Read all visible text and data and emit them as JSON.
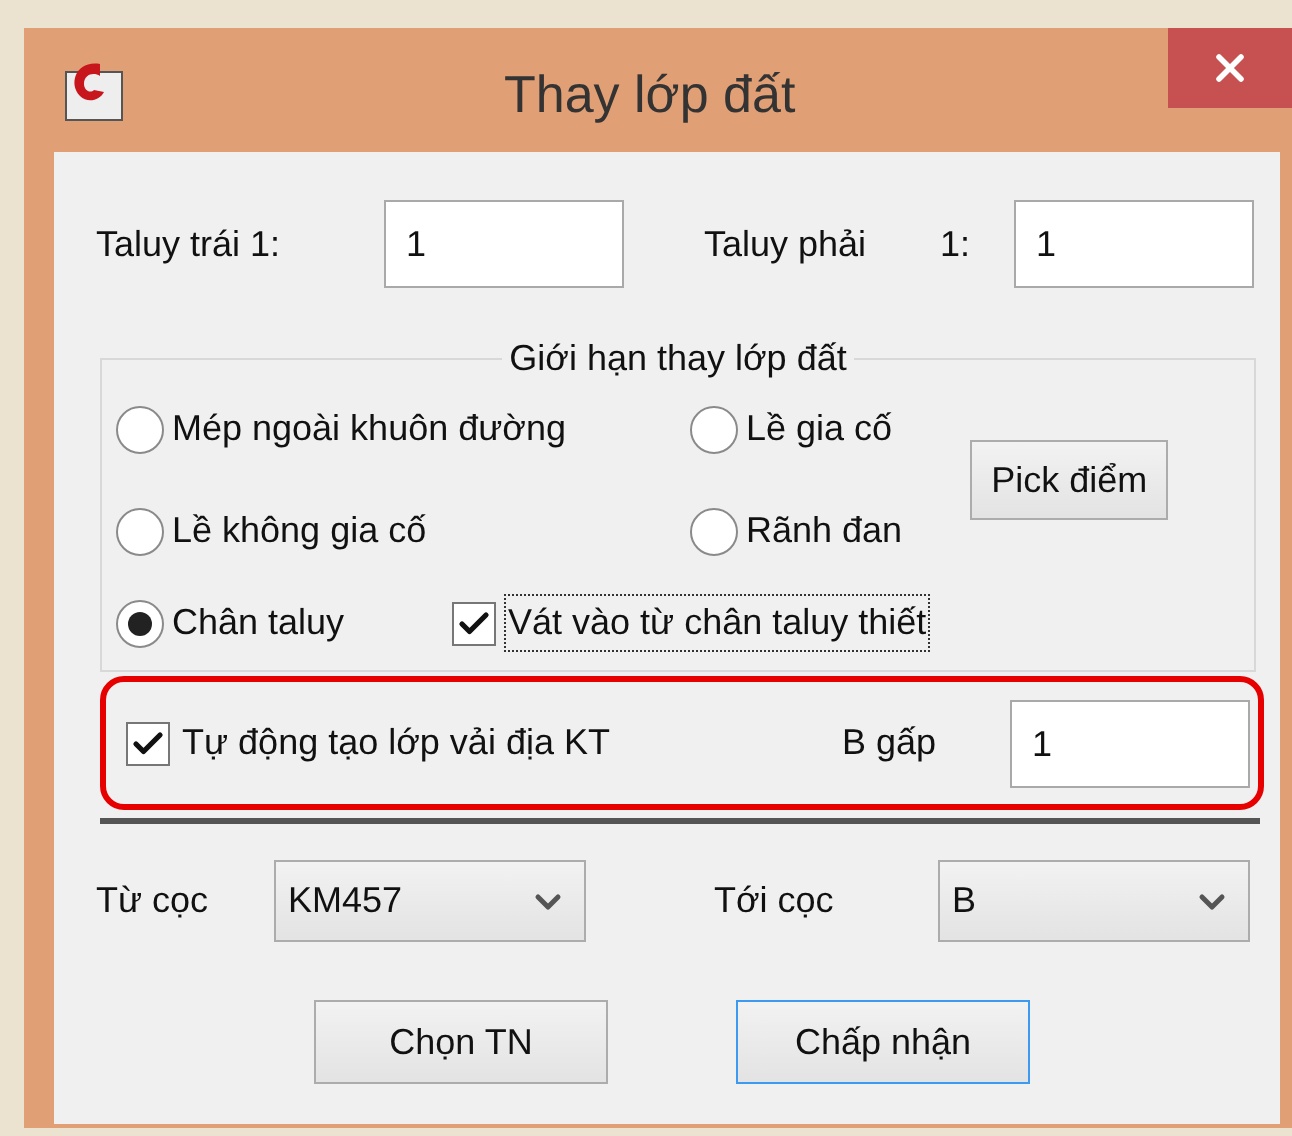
{
  "window": {
    "title": "Thay lớp đất"
  },
  "taluy": [
    {
      "label": "Taluy trái 1:",
      "value": "1"
    },
    {
      "label": "Taluy phải",
      "ratio": "1:",
      "value": "1"
    }
  ],
  "limit_group": {
    "title": "Giới hạn thay lớp đất",
    "options": [
      {
        "label": "Mép ngoài khuôn đường",
        "selected": false
      },
      {
        "label": "Lề gia cố",
        "selected": false
      },
      {
        "label": "Lề không gia cố",
        "selected": false
      },
      {
        "label": "Rãnh đan",
        "selected": false
      },
      {
        "label": "Chân taluy",
        "selected": true
      }
    ],
    "pick_button": "Pick điểm",
    "bevel": {
      "label": "Vát vào từ chân taluy thiết",
      "checked": true,
      "focused": true
    }
  },
  "geotextile": {
    "label": "Tự động tạo lớp vải địa KT",
    "checked": true,
    "highlighted": true,
    "fold_label": "B gấp",
    "fold_value": "1"
  },
  "stations": [
    {
      "label": "Từ cọc",
      "value": "KM457"
    },
    {
      "label": "Tới cọc",
      "value": "B"
    }
  ],
  "buttons": [
    {
      "label": "Chọn TN",
      "default": false
    },
    {
      "label": "Chấp nhận",
      "default": true
    }
  ]
}
